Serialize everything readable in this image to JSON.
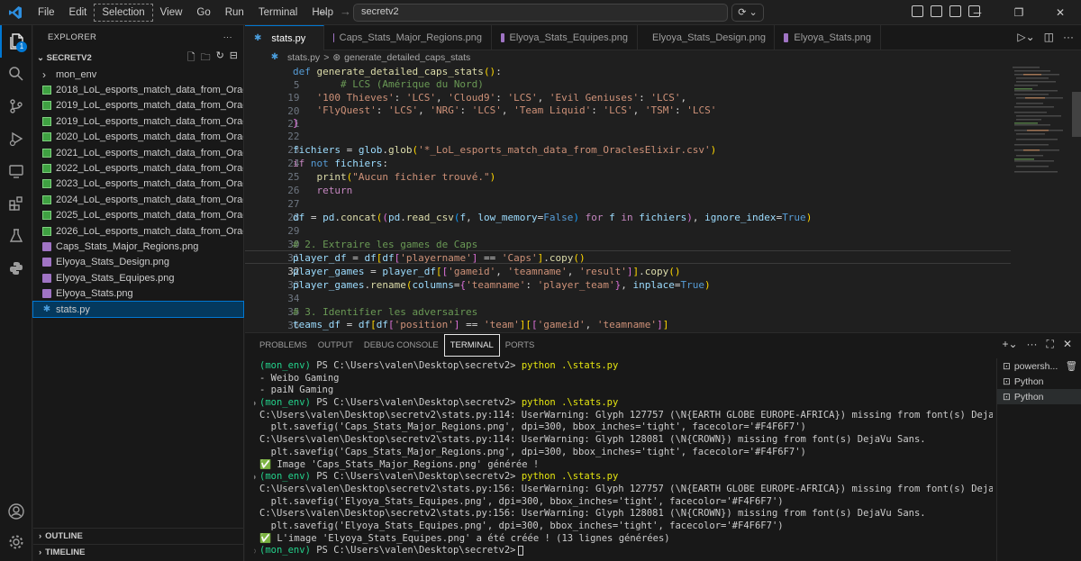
{
  "titlebar": {
    "menus": [
      "File",
      "Edit",
      "Selection",
      "View",
      "Go",
      "Run",
      "Terminal",
      "Help"
    ],
    "search_text": "secretv2"
  },
  "activity": {
    "explorer_badge": "1"
  },
  "sidebar": {
    "header": "EXPLORER",
    "more": "···",
    "folder": "SECRETV2",
    "items": [
      {
        "label": "mon_env",
        "type": "folder"
      },
      {
        "label": "2018_LoL_esports_match_data_from_OraclesElixir.csv",
        "type": "csv"
      },
      {
        "label": "2019_LoL_esports_match_data_from_OraclesElixir.csv",
        "type": "csv"
      },
      {
        "label": "2019_LoL_esports_match_data_from_OraclesElixir.csv",
        "type": "csv"
      },
      {
        "label": "2020_LoL_esports_match_data_from_OraclesElixir.csv",
        "type": "csv"
      },
      {
        "label": "2021_LoL_esports_match_data_from_OraclesElixir.csv",
        "type": "csv"
      },
      {
        "label": "2022_LoL_esports_match_data_from_OraclesElixir.csv",
        "type": "csv"
      },
      {
        "label": "2023_LoL_esports_match_data_from_OraclesElixir.csv",
        "type": "csv"
      },
      {
        "label": "2024_LoL_esports_match_data_from_OraclesElixir.csv",
        "type": "csv"
      },
      {
        "label": "2025_LoL_esports_match_data_from_OraclesElixir.csv",
        "type": "csv"
      },
      {
        "label": "2026_LoL_esports_match_data_from_OraclesElixir.csv",
        "type": "csv"
      },
      {
        "label": "Caps_Stats_Major_Regions.png",
        "type": "png"
      },
      {
        "label": "Elyoya_Stats_Design.png",
        "type": "png"
      },
      {
        "label": "Elyoya_Stats_Equipes.png",
        "type": "png"
      },
      {
        "label": "Elyoya_Stats.png",
        "type": "png"
      },
      {
        "label": "stats.py",
        "type": "py"
      }
    ],
    "outline": "OUTLINE",
    "timeline": "TIMELINE"
  },
  "tabs": [
    "stats.py",
    "Caps_Stats_Major_Regions.png",
    "Elyoya_Stats_Equipes.png",
    "Elyoya_Stats_Design.png",
    "Elyoya_Stats.png"
  ],
  "breadcrumb": {
    "file": "stats.py",
    "sep": ">",
    "symbol": "generate_detailed_caps_stats"
  },
  "editor": {
    "line_numbers": [
      "5",
      "19",
      "20",
      "21",
      "22",
      "23",
      "24",
      "25",
      "26",
      "27",
      "28",
      "29",
      "30",
      "31",
      "32",
      "33",
      "34",
      "35",
      "36",
      "37"
    ],
    "current_line": "32"
  },
  "panel": {
    "tabs": [
      "PROBLEMS",
      "OUTPUT",
      "DEBUG CONSOLE",
      "TERMINAL",
      "PORTS"
    ],
    "terminals": [
      "powersh...",
      "Python",
      "Python"
    ]
  },
  "terminal": {
    "prompt_env": "(mon_env)",
    "prompt_path": "PS C:\\Users\\valen\\Desktop\\secretv2>",
    "command": "python .\\stats.py",
    "lines": [
      "- Weibo Gaming",
      "- paiN Gaming",
      "C:\\Users\\valen\\Desktop\\secretv2\\stats.py:114: UserWarning: Glyph 127757 (\\N{EARTH GLOBE EUROPE-AFRICA}) missing from font(s) DejaVu Sans.",
      "  plt.savefig('Caps_Stats_Major_Regions.png', dpi=300, bbox_inches='tight', facecolor='#F4F6F7')",
      "C:\\Users\\valen\\Desktop\\secretv2\\stats.py:114: UserWarning: Glyph 128081 (\\N{CROWN}) missing from font(s) DejaVu Sans.",
      "  plt.savefig('Caps_Stats_Major_Regions.png', dpi=300, bbox_inches='tight', facecolor='#F4F6F7')",
      "Image 'Caps_Stats_Major_Regions.png' générée !",
      "C:\\Users\\valen\\Desktop\\secretv2\\stats.py:156: UserWarning: Glyph 127757 (\\N{EARTH GLOBE EUROPE-AFRICA}) missing from font(s) DejaVu Sans.",
      "  plt.savefig('Elyoya_Stats_Equipes.png', dpi=300, bbox_inches='tight', facecolor='#F4F6F7')",
      "C:\\Users\\valen\\Desktop\\secretv2\\stats.py:156: UserWarning: Glyph 128081 (\\N{CROWN}) missing from font(s) DejaVu Sans.",
      "  plt.savefig('Elyoya_Stats_Equipes.png', dpi=300, bbox_inches='tight', facecolor='#F4F6F7')",
      "L'image 'Elyoya_Stats_Equipes.png' a été créée ! (13 lignes générées)"
    ]
  },
  "colors": {
    "accent": "#0078d4",
    "terminal_green": "#23d18b",
    "terminal_yellow": "#e5e510"
  }
}
